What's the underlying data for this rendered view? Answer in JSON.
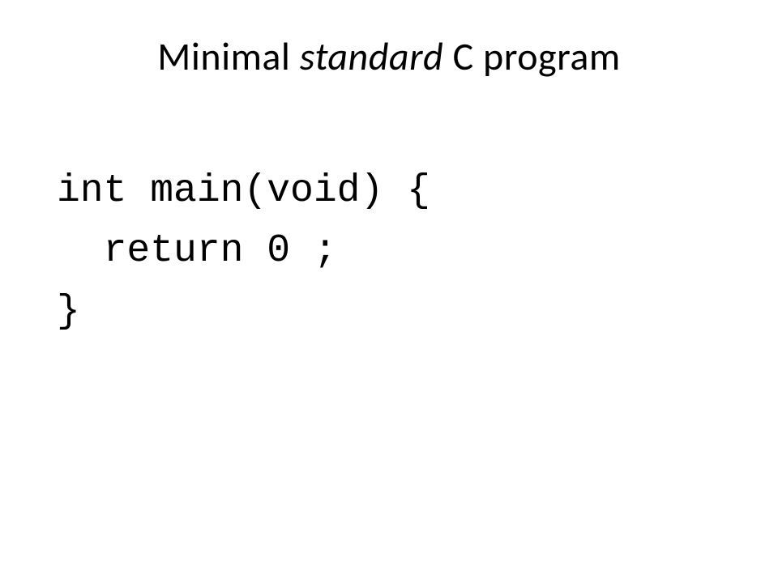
{
  "title": {
    "part1": "Minimal ",
    "italic": "standard",
    "part2": " C program"
  },
  "code": {
    "line1": "int main(void) {",
    "line2": "  return 0 ;",
    "line3": "}"
  }
}
